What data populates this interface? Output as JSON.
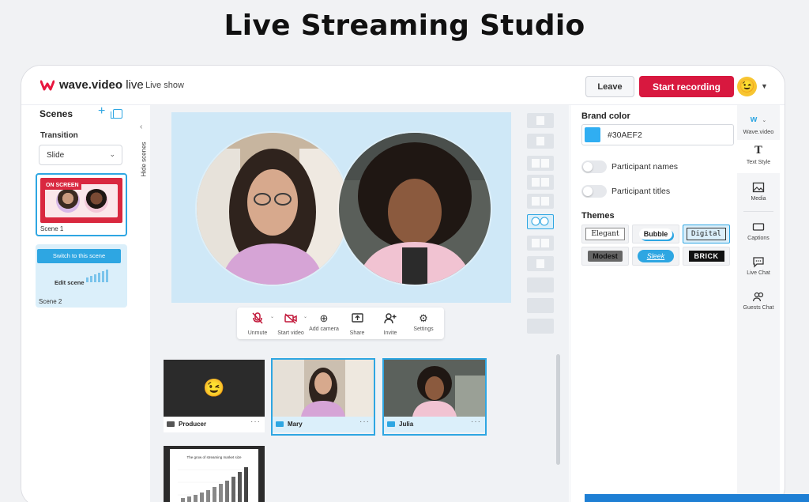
{
  "page": {
    "title": "Live Streaming Studio"
  },
  "header": {
    "logo_text": "wave.video",
    "logo_suffix": " live",
    "show_name": "Live show",
    "leave_label": "Leave",
    "record_label": "Start recording",
    "avatar_emoji": "😉"
  },
  "scenes": {
    "title": "Scenes",
    "transition_label": "Transition",
    "transition_value": "Slide",
    "hide_label": "Hide scenes",
    "items": [
      {
        "label": "Scene 1",
        "badge": "ON SCREEN"
      },
      {
        "label": "Scene 2",
        "switch_label": "Switch to this scene",
        "edit_label": "Edit scene"
      }
    ]
  },
  "controls": [
    {
      "label": "Unmute",
      "icon": "mic-off-icon"
    },
    {
      "label": "Start video",
      "icon": "camera-off-icon"
    },
    {
      "label": "Add camera",
      "icon": "add-camera-icon"
    },
    {
      "label": "Share",
      "icon": "share-screen-icon"
    },
    {
      "label": "Invite",
      "icon": "invite-icon"
    },
    {
      "label": "Settings",
      "icon": "gear-icon"
    }
  ],
  "participants": [
    {
      "name": "Producer",
      "emoji": "😉"
    },
    {
      "name": "Mary"
    },
    {
      "name": "Julia"
    }
  ],
  "slide": {
    "title": "The grow of streaming market size"
  },
  "brand": {
    "title": "Brand color",
    "color_value": "#30AEF2",
    "swatch_color": "#30AEF2",
    "toggles": [
      {
        "label": "Participant names",
        "on": false
      },
      {
        "label": "Participant titles",
        "on": false
      }
    ],
    "themes_title": "Themes",
    "themes": [
      "Elegant",
      "Bubble",
      "Digital",
      "Modest",
      "Sleek",
      "BRICK"
    ],
    "selected_theme": "Digital"
  },
  "rail": {
    "logo_label": "Wave.video",
    "items": [
      {
        "label": "Text Style",
        "icon": "text-style-icon"
      },
      {
        "label": "Media",
        "icon": "image-icon"
      },
      {
        "label": "Captions",
        "icon": "captions-icon"
      },
      {
        "label": "Live Chat",
        "icon": "chat-icon"
      },
      {
        "label": "Guests Chat",
        "icon": "guests-icon"
      }
    ]
  },
  "colors": {
    "accent": "#2ea6e2",
    "record": "#d8183f",
    "stage": "#cfe8f7"
  }
}
